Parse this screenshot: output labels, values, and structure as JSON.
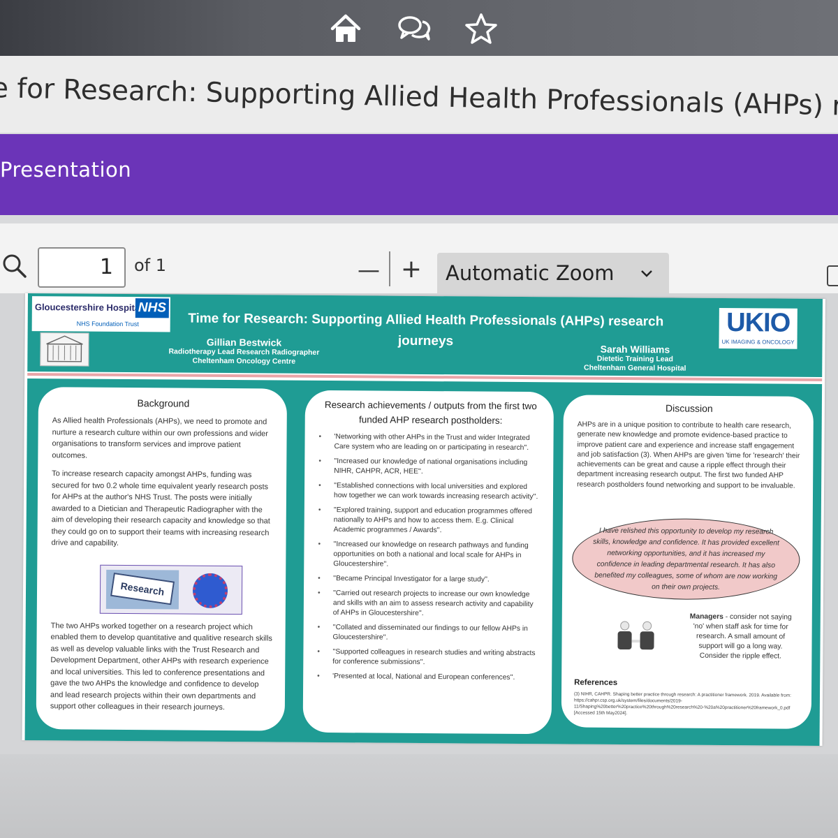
{
  "nav": {
    "icons": [
      "home-icon",
      "chat-icon",
      "star-icon"
    ]
  },
  "page": {
    "title": "e for Research: Supporting Allied Health Professionals (AHPs) resea",
    "section": "Presentation"
  },
  "pdf_toolbar": {
    "page_number": "1",
    "page_total": "of 1",
    "zoom_out": "—",
    "zoom_in": "+",
    "zoom": "Automatic Zoom"
  },
  "poster": {
    "logo_left": {
      "name": "Gloucestershire Hospitals",
      "badge": "NHS",
      "sub": "NHS Foundation Trust"
    },
    "title": "Time for Research: Supporting Allied Health Professionals (AHPs) research journeys",
    "author1": {
      "name": "Gillian Bestwick",
      "role": "Radiotherapy Lead Research Radiographer",
      "org": "Cheltenham Oncology Centre"
    },
    "author2": {
      "name": "Sarah Williams",
      "role": "Dietetic Training Lead",
      "org": "Cheltenham General Hospital"
    },
    "logo_right": {
      "name": "UKIO",
      "sub": "UK IMAGING & ONCOLOGY"
    },
    "background": {
      "heading": "Background",
      "p1": "As Allied health Professionals (AHPs), we need to promote and nurture a research culture within our own professions and wider organisations to transform services and improve patient outcomes.",
      "p2": "To increase research capacity amongst AHPs, funding was secured for two 0.2 whole time equivalent yearly research posts for AHPs at the author's NHS Trust. The posts were initially awarded to a Dietician and Therapeutic Radiographer with the aim of developing their research capacity and knowledge so that they could go on to support their teams with increasing research drive and capability.",
      "image_label": "Research",
      "p3": "The two AHPs worked together on a research project which enabled them to develop quantitative and qualitive research skills as well as develop valuable links with the Trust Research and Development Department, other AHPs with research experience and local universities. This led to conference presentations and gave the two AHPs the knowledge and confidence to develop and lead research projects within their own departments and support other colleagues in their research journeys."
    },
    "achievements": {
      "heading": "Research achievements / outputs from the first two funded AHP research postholders:",
      "items": [
        "'Networking with other AHPs in the Trust and wider Integrated Care system who are leading on or participating in research''.",
        "''Increased our knowledge of national organisations including NIHR, CAHPR, ACR, HEE''.",
        "''Established connections with local universities and explored how together we can work towards increasing research activity''.",
        "''Explored training, support and education programmes offered nationally to AHPs and how to access them. E.g. Clinical Academic programmes / Awards''.",
        "''Increased our knowledge on research pathways and funding opportunities on both a national and local scale for AHPs in Gloucestershire''.",
        "''Became Principal Investigator for a large study''.",
        "''Carried out research projects to increase our own knowledge and skills with an aim to assess research activity and capability of AHPs in Gloucestershire''.",
        "''Collated and disseminated our findings to our fellow AHPs in Gloucestershire''.",
        "''Supported colleagues in research studies and writing abstracts for conference submissions''.",
        "'Presented at local, National and European conferences''."
      ]
    },
    "discussion": {
      "heading": "Discussion",
      "p1": "AHPs are in a unique position to contribute to health care research, generate new knowledge and promote evidence-based practice to improve patient care and experience and increase staff engagement and job satisfaction (3). When AHPs are given 'time for 'research' their achievements can be great and cause a ripple effect through their department increasing research output. The first two funded AHP research postholders found networking and support to be invaluable.",
      "quote": "I have relished this opportunity to develop my research skills, knowledge and confidence. It has provided excellent networking opportunities, and it has increased my confidence in leading departmental research. It has also benefited my colleagues, some of whom are now working on their own projects.",
      "managers_label": "Managers",
      "managers_text": " - consider not saying 'no' when staff ask for time for research. A small amount of support will go a long way. Consider the ripple effect.",
      "refs_heading": "References",
      "refs_text": "(3) NIHR, CAHPR. Shaping better practice through research: A practitioner framework. 2019. Available from: https://cahpr.csp.org.uk/system/files/documents/2019-11/Shaping%20better%20practice%20through%20research%20-%20a%20practitioner%20framework_0.pdf [Accessed 15th May2024]."
    }
  }
}
